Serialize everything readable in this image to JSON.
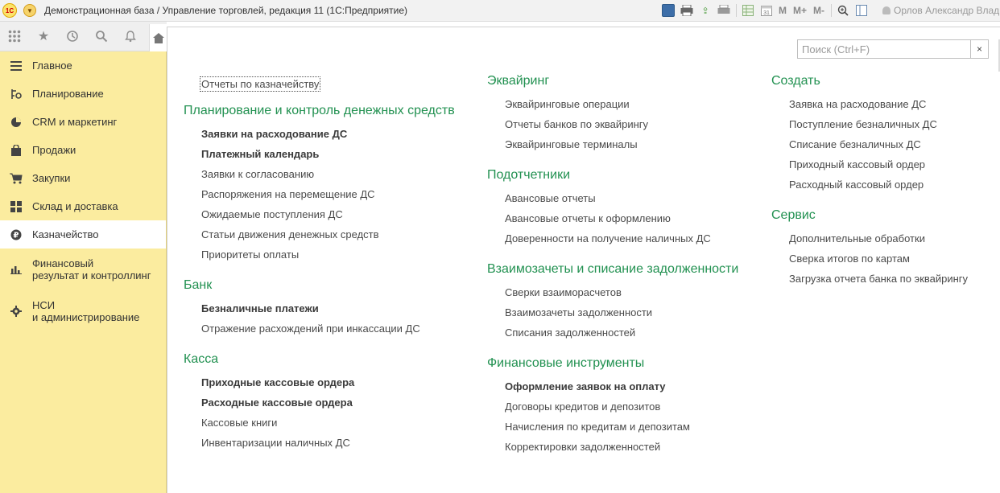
{
  "window": {
    "title": "Демонстрационная база / Управление торговлей, редакция 11   (1С:Предприятие)",
    "logo_text": "1С",
    "user": "Орлов Александр Владим",
    "toolbar_marks": [
      "M",
      "M+",
      "M-"
    ]
  },
  "navstrip": {
    "icons": [
      "apps-grid-icon",
      "star-icon",
      "history-icon",
      "search-icon",
      "bell-icon"
    ],
    "home_icon": "home-icon"
  },
  "sidebar": {
    "items": [
      {
        "label": "Главное",
        "icon": "menu-lines-icon"
      },
      {
        "label": "Планирование",
        "icon": "planning-icon"
      },
      {
        "label": "CRM и маркетинг",
        "icon": "pie-chart-icon"
      },
      {
        "label": "Продажи",
        "icon": "shopping-bag-icon"
      },
      {
        "label": "Закупки",
        "icon": "cart-icon"
      },
      {
        "label": "Склад и доставка",
        "icon": "warehouse-icon"
      },
      {
        "label": "Казначейство",
        "icon": "ruble-icon",
        "active": true
      },
      {
        "label": "Финансовый результат и контроллинг",
        "line1": "Финансовый",
        "line2": "результат и контроллинг",
        "icon": "bar-chart-icon"
      },
      {
        "label": "НСИ и администрирование",
        "line1": "НСИ",
        "line2": "и администрирование",
        "icon": "gear-icon"
      }
    ]
  },
  "search": {
    "placeholder": "Поиск (Ctrl+F)",
    "value": "",
    "clear_label": "×"
  },
  "columns": {
    "left": {
      "top_link": "Отчеты по казначейству",
      "groups": [
        {
          "title": "Планирование и контроль денежных средств",
          "links": [
            {
              "text": "Заявки на расходование ДС",
              "bold": true
            },
            {
              "text": "Платежный календарь",
              "bold": true
            },
            {
              "text": "Заявки к согласованию",
              "bold": false
            },
            {
              "text": "Распоряжения на перемещение ДС",
              "bold": false
            },
            {
              "text": "Ожидаемые поступления ДС",
              "bold": false
            },
            {
              "text": "Статьи движения денежных средств",
              "bold": false
            },
            {
              "text": "Приоритеты оплаты",
              "bold": false
            }
          ]
        },
        {
          "title": "Банк",
          "links": [
            {
              "text": "Безналичные платежи",
              "bold": true
            },
            {
              "text": "Отражение расхождений при инкассации ДС",
              "bold": false
            }
          ]
        },
        {
          "title": "Касса",
          "links": [
            {
              "text": "Приходные кассовые ордера",
              "bold": true
            },
            {
              "text": "Расходные кассовые ордера",
              "bold": true
            },
            {
              "text": "Кассовые книги",
              "bold": false
            },
            {
              "text": "Инвентаризации наличных ДС",
              "bold": false
            }
          ]
        }
      ]
    },
    "middle": {
      "groups": [
        {
          "title": "Эквайринг",
          "links": [
            {
              "text": "Эквайринговые операции",
              "bold": false
            },
            {
              "text": "Отчеты банков по эквайрингу",
              "bold": false
            },
            {
              "text": "Эквайринговые терминалы",
              "bold": false
            }
          ]
        },
        {
          "title": "Подотчетники",
          "links": [
            {
              "text": "Авансовые отчеты",
              "bold": false
            },
            {
              "text": "Авансовые отчеты к оформлению",
              "bold": false
            },
            {
              "text": "Доверенности на получение наличных ДС",
              "bold": false
            }
          ]
        },
        {
          "title": "Взаимозачеты и списание задолженности",
          "links": [
            {
              "text": "Сверки взаиморасчетов",
              "bold": false
            },
            {
              "text": "Взаимозачеты задолженности",
              "bold": false
            },
            {
              "text": "Списания задолженностей",
              "bold": false
            }
          ]
        },
        {
          "title": "Финансовые инструменты",
          "links": [
            {
              "text": "Оформление заявок на оплату",
              "bold": true
            },
            {
              "text": "Договоры кредитов и депозитов",
              "bold": false
            },
            {
              "text": "Начисления по кредитам и депозитам",
              "bold": false
            },
            {
              "text": "Корректировки задолженностей",
              "bold": false
            }
          ]
        }
      ]
    },
    "right": {
      "groups": [
        {
          "title": "Создать",
          "links": [
            {
              "text": "Заявка на расходование ДС",
              "bold": false
            },
            {
              "text": "Поступление безналичных ДС",
              "bold": false
            },
            {
              "text": "Списание безналичных ДС",
              "bold": false
            },
            {
              "text": "Приходный кассовый ордер",
              "bold": false
            },
            {
              "text": "Расходный кассовый ордер",
              "bold": false
            }
          ]
        },
        {
          "title": "Сервис",
          "links": [
            {
              "text": "Дополнительные обработки",
              "bold": false
            },
            {
              "text": "Сверка итогов по картам",
              "bold": false
            },
            {
              "text": "Загрузка отчета банка по эквайрингу",
              "bold": false
            }
          ]
        }
      ]
    }
  },
  "colors": {
    "sidebar_bg": "#fbec9f",
    "group_title": "#229151",
    "active_item_bg": "#ffffff"
  }
}
